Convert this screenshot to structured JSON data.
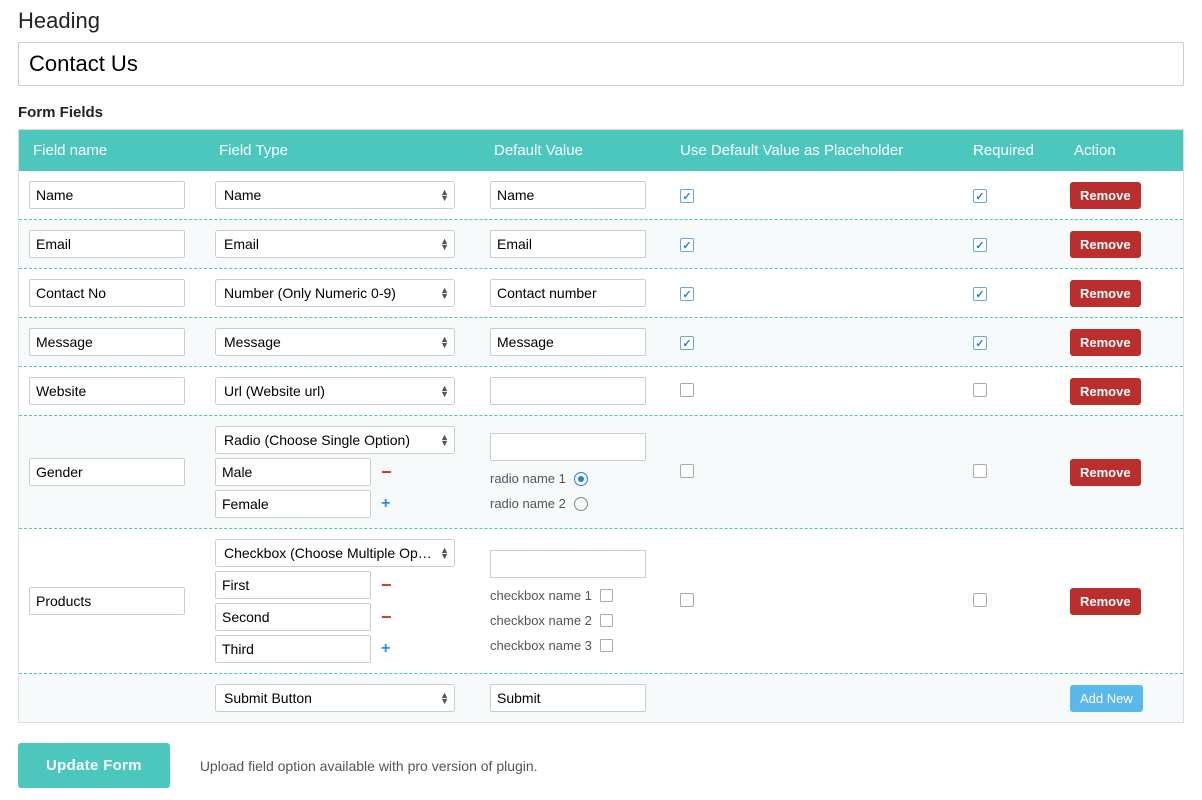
{
  "heading": {
    "label": "Heading",
    "value": "Contact Us"
  },
  "section_label": "Form Fields",
  "columns": {
    "name": "Field name",
    "type": "Field Type",
    "default": "Default Value",
    "placeholder": "Use Default Value as Placeholder",
    "required": "Required",
    "action": "Action"
  },
  "rows": [
    {
      "name": "Name",
      "type": "Name",
      "default": "Name",
      "placeholder_checked": true,
      "required_checked": true,
      "action": "Remove"
    },
    {
      "name": "Email",
      "type": "Email",
      "default": "Email",
      "placeholder_checked": true,
      "required_checked": true,
      "action": "Remove"
    },
    {
      "name": "Contact No",
      "type": "Number (Only Numeric 0-9)",
      "default": "Contact number",
      "placeholder_checked": true,
      "required_checked": true,
      "action": "Remove"
    },
    {
      "name": "Message",
      "type": "Message",
      "default": "Message",
      "placeholder_checked": true,
      "required_checked": true,
      "action": "Remove"
    },
    {
      "name": "Website",
      "type": "Url (Website url)",
      "default": "",
      "placeholder_checked": false,
      "required_checked": false,
      "action": "Remove"
    }
  ],
  "radio_row": {
    "name": "Gender",
    "type": "Radio (Choose Single Option)",
    "options": [
      "Male",
      "Female"
    ],
    "default": "",
    "preview": [
      "radio name 1",
      "radio name 2"
    ],
    "selected_index": 0,
    "action": "Remove"
  },
  "checkbox_row": {
    "name": "Products",
    "type": "Checkbox (Choose Multiple Options)",
    "options": [
      "First",
      "Second",
      "Third"
    ],
    "default": "",
    "preview": [
      "checkbox name 1",
      "checkbox name 2",
      "checkbox name 3"
    ],
    "action": "Remove"
  },
  "submit_row": {
    "type": "Submit Button",
    "default": "Submit",
    "action": "Add New"
  },
  "footer": {
    "update_label": "Update Form",
    "note": "Upload field option available with pro version of plugin."
  }
}
